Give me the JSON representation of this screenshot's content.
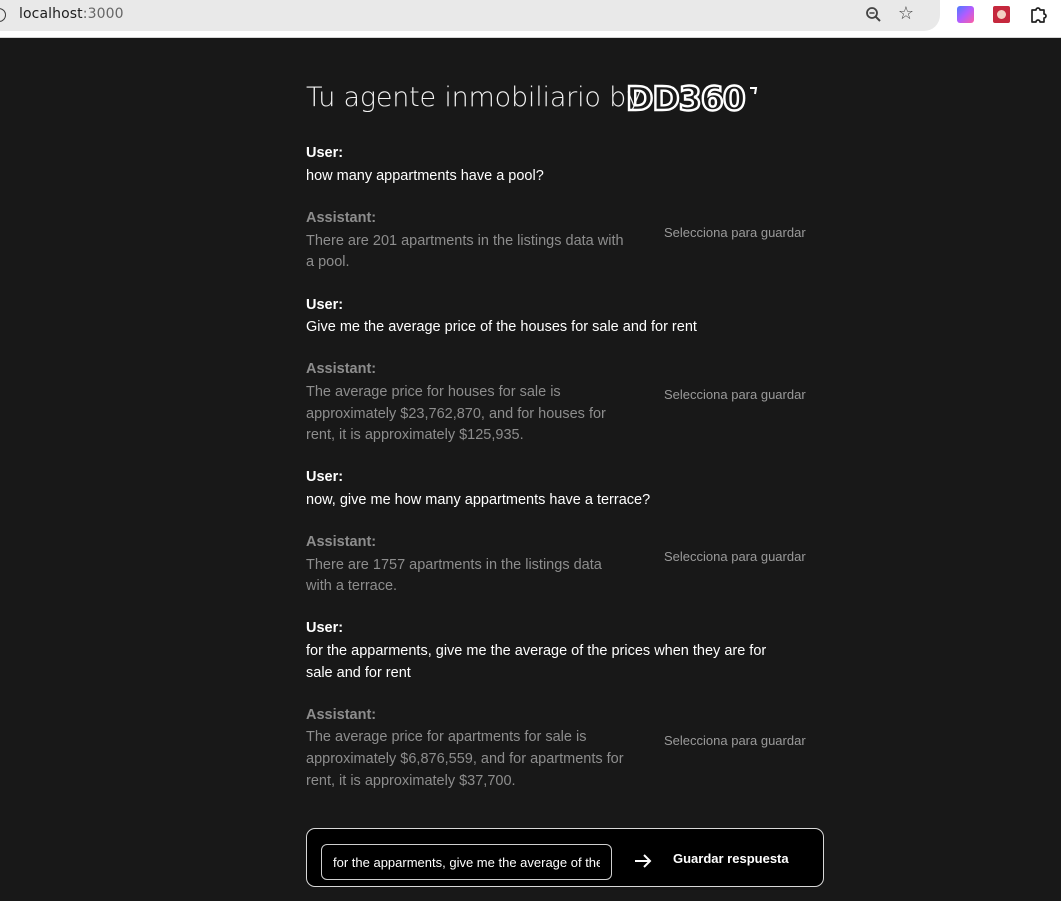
{
  "browser": {
    "url_host": "localhost",
    "url_port": ":3000",
    "info_icon": "i"
  },
  "page": {
    "title": "Tu agente inmobiliario by",
    "logo_text": "DD360"
  },
  "messages": [
    {
      "role": "User:",
      "text": [
        "how many appartments have a pool?"
      ]
    },
    {
      "role": "Assistant:",
      "text": [
        "There are 201 apartments in the listings data with",
        "a pool."
      ],
      "save_label": "Selecciona para guardar"
    },
    {
      "role": "User:",
      "text": [
        "Give me the average price of the houses for sale and for rent"
      ]
    },
    {
      "role": "Assistant:",
      "text": [
        "The average price for houses for sale is",
        "approximately $23,762,870, and for houses for",
        "rent, it is approximately $125,935."
      ],
      "save_label": "Selecciona para guardar"
    },
    {
      "role": "User:",
      "text": [
        "now, give me how many appartments have a terrace?"
      ]
    },
    {
      "role": "Assistant:",
      "text": [
        "There are 1757 apartments in the listings data",
        "with a terrace."
      ],
      "save_label": "Selecciona para guardar"
    },
    {
      "role": "User:",
      "text": [
        "for the apparments, give me the average of the prices when they are for",
        "sale and for rent"
      ]
    },
    {
      "role": "Assistant:",
      "text": [
        "The average price for apartments for sale is",
        "approximately $6,876,559, and for apartments for",
        "rent, it is approximately $37,700."
      ],
      "save_label": "Selecciona para guardar"
    }
  ],
  "composer": {
    "input_value": "for the apparments, give me the average of the prices when they are for sale and for rent",
    "send_icon": "arrow-right-icon",
    "save_button_label": "Guardar respuesta"
  }
}
